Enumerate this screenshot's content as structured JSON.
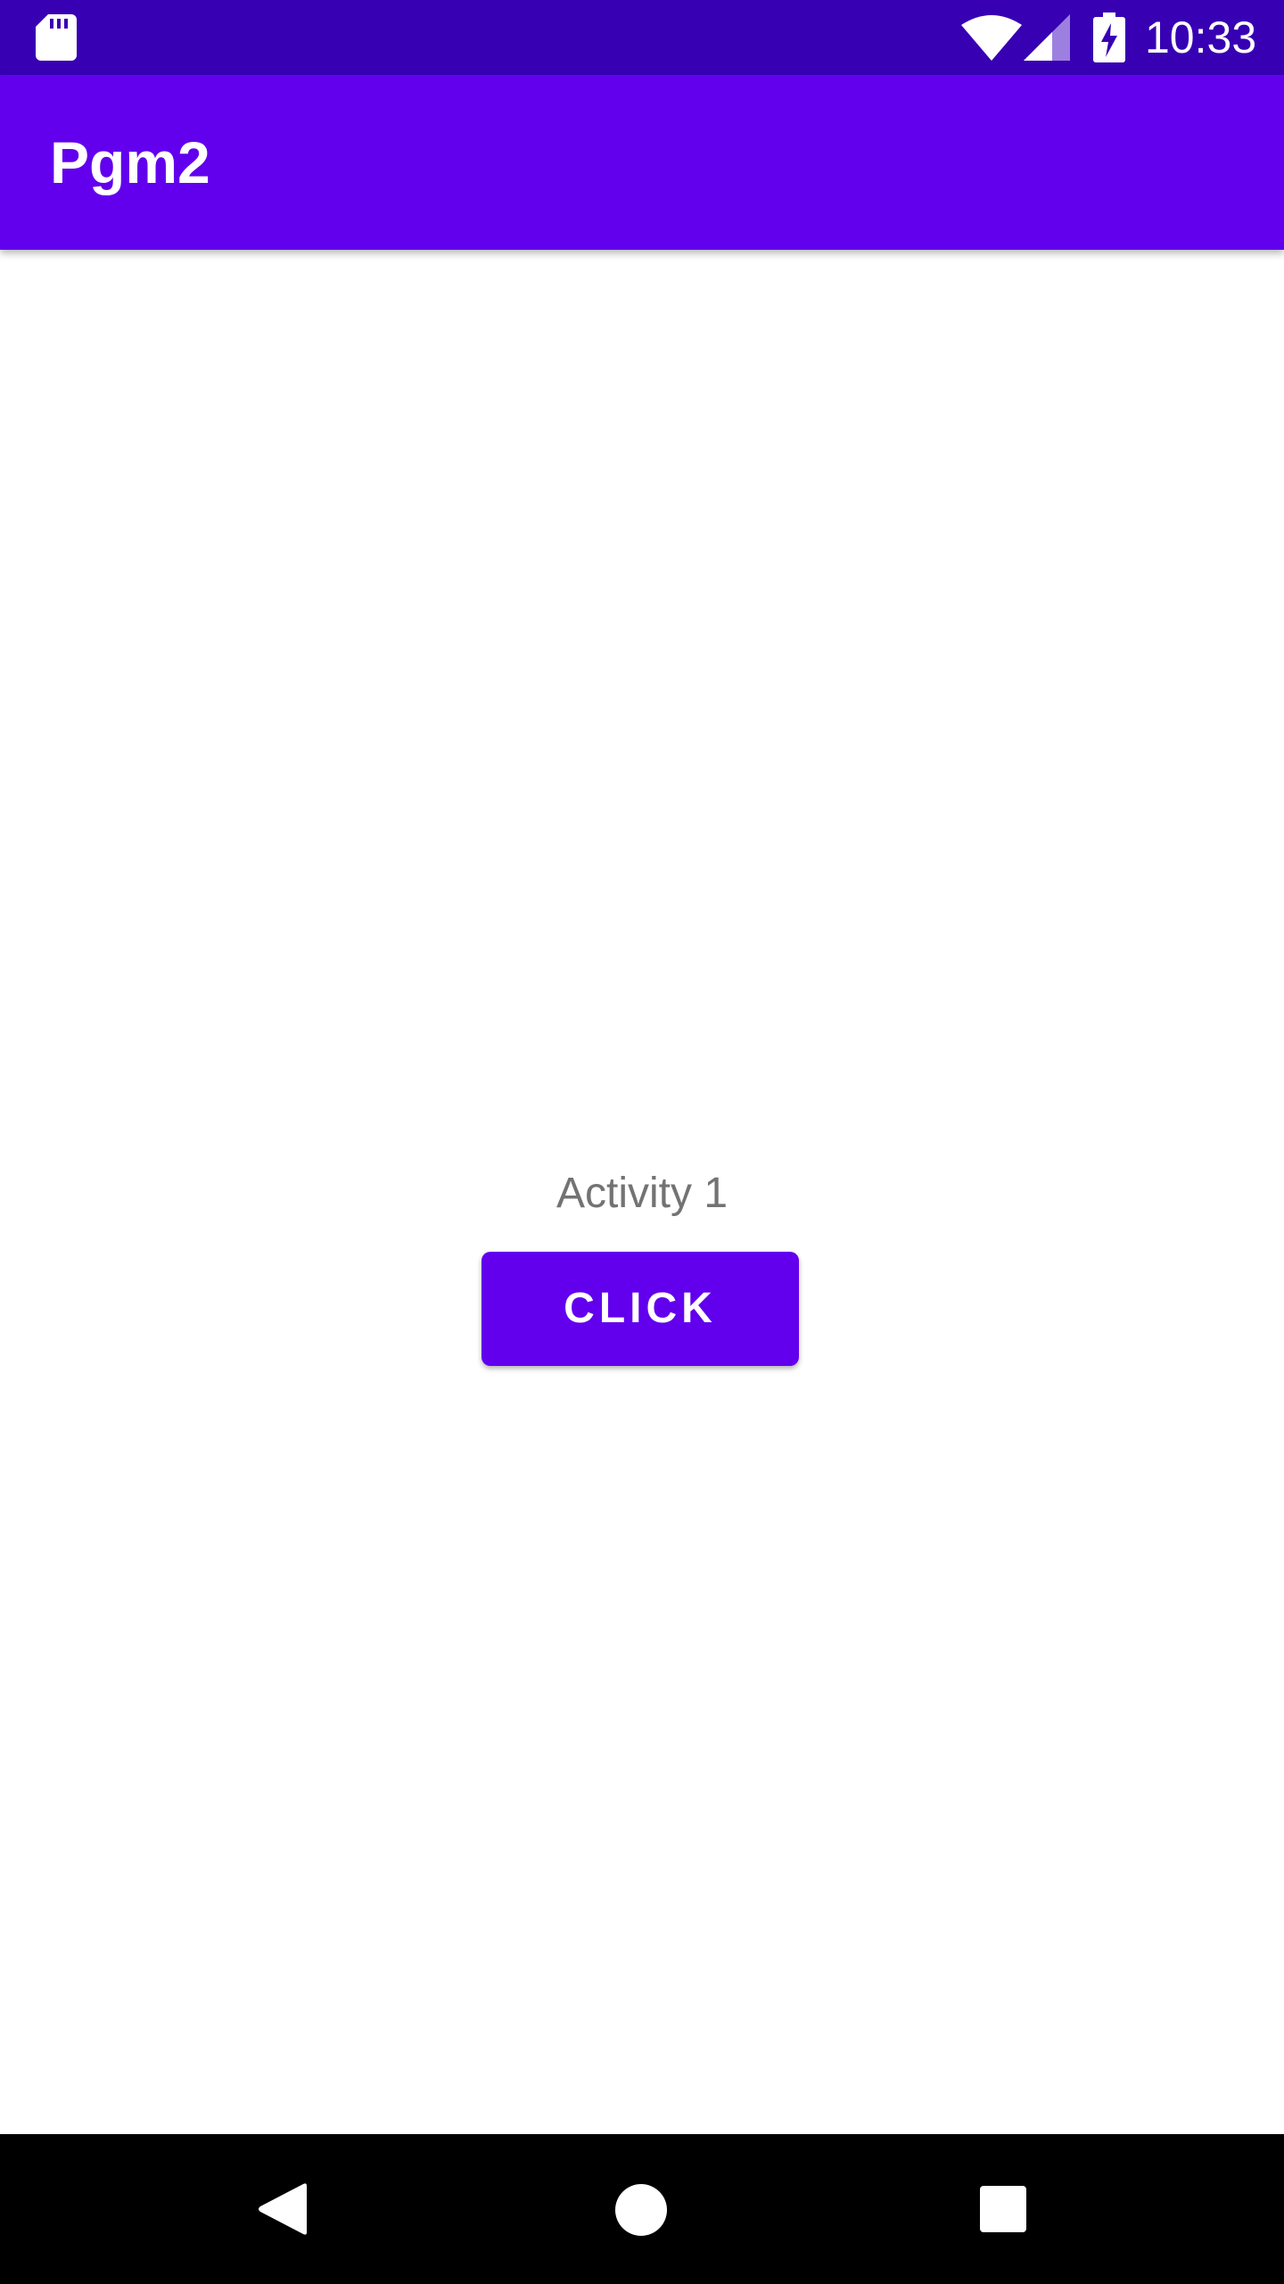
{
  "status_bar": {
    "time": "10:33",
    "icons": [
      "sd-card-icon",
      "wifi-icon",
      "signal-icon",
      "battery-charging-icon"
    ],
    "background": "#3700b3"
  },
  "app_bar": {
    "title": "Pgm2",
    "background": "#6200ee"
  },
  "main": {
    "activity_label": "Activity 1",
    "click_button_label": "CLICK",
    "accent": "#6200ee"
  },
  "nav_bar": {
    "icons": [
      "back-icon",
      "home-icon",
      "recents-icon"
    ]
  }
}
